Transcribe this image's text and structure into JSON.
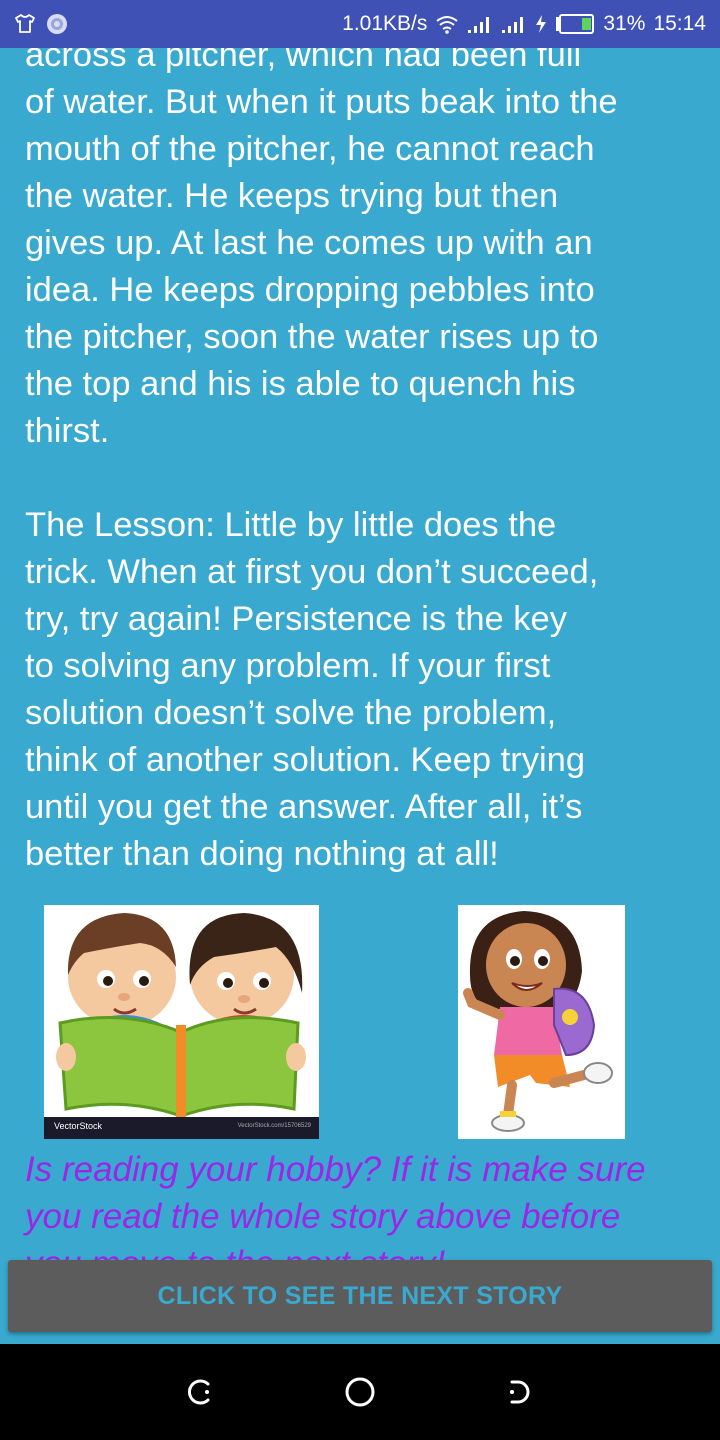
{
  "status_bar": {
    "speed": "1.01KB/s",
    "battery": "31%",
    "time": "15:14"
  },
  "story": {
    "paragraph1_lines": [
      "across a pitcher, which had been full",
      "of water. But when it puts beak into the",
      "mouth of the pitcher, he cannot reach",
      "the water. He keeps trying but then",
      "gives up. At last he comes up with an",
      "idea. He keeps dropping pebbles into",
      "the pitcher, soon the water rises up to",
      "the top and his is able to quench his",
      "thirst."
    ],
    "lesson_lines": [
      "The Lesson: Little by little does the",
      "trick. When at first you don’t succeed,",
      "try, try again! Persistence is the key",
      "to solving any problem. If your first",
      "solution doesn’t solve the problem,",
      "think of another solution. Keep trying",
      "until you get the answer. After all, it’s",
      "better than doing nothing at all!"
    ]
  },
  "images": {
    "kids_reading_watermark": "VectorStock",
    "kids_reading_url_text": "VectorStock.com/15706529"
  },
  "promo": {
    "lines": [
      "Is reading your hobby? If it is make sure",
      "you read the whole story above before",
      "you move to the next story!"
    ]
  },
  "next_button": {
    "label": "CLICK TO SEE THE NEXT STORY"
  },
  "colors": {
    "background": "#3aa9d0",
    "status_bar": "#3f51b5",
    "promo_text": "#9b27e6",
    "button_bg": "#5c5c5c",
    "button_text": "#3aa9d0"
  },
  "icons": {
    "status_left": [
      "shirt-icon",
      "aperture-icon"
    ],
    "status_right": [
      "wifi-icon",
      "signal-icon",
      "signal-icon",
      "charging-icon",
      "battery-icon"
    ],
    "nav": [
      "back-icon",
      "home-icon",
      "recent-apps-icon"
    ]
  }
}
